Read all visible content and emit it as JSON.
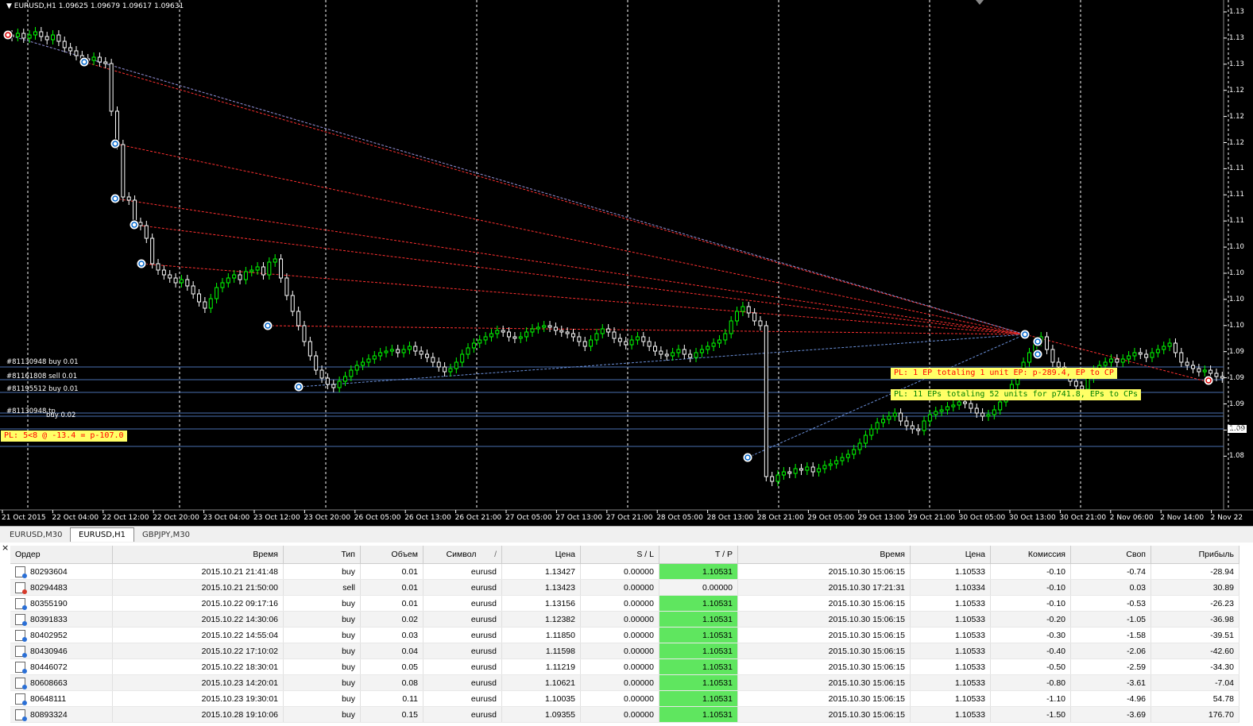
{
  "chart": {
    "title": "▼ EURUSD,H1  1.09625 1.09679 1.09617 1.09631",
    "price_axis": [
      "1.13",
      "1.13",
      "1.13",
      "1.12",
      "1.12",
      "1.12",
      "1.11",
      "1.11",
      "1.11",
      "1.10",
      "1.10",
      "1.10",
      "1.10",
      "1.09",
      "1.09",
      "1.09",
      "1.09",
      "1.08"
    ],
    "current_price": "1.09",
    "time_axis": [
      "21 Oct 2015",
      "22 Oct 04:00",
      "22 Oct 12:00",
      "22 Oct 20:00",
      "23 Oct 04:00",
      "23 Oct 12:00",
      "23 Oct 20:00",
      "26 Oct 05:00",
      "26 Oct 13:00",
      "26 Oct 21:00",
      "27 Oct 05:00",
      "27 Oct 13:00",
      "27 Oct 21:00",
      "28 Oct 05:00",
      "28 Oct 13:00",
      "28 Oct 21:00",
      "29 Oct 05:00",
      "29 Oct 13:00",
      "29 Oct 21:00",
      "30 Oct 05:00",
      "30 Oct 13:00",
      "30 Oct 21:00",
      "2 Nov 06:00",
      "2 Nov 14:00",
      "2 Nov 22"
    ],
    "order_labels": [
      "#81130948 buy 0.01",
      "#81161808 sell 0.01",
      "#81195512 buy 0.01",
      "#81130948 tp",
      "buy 0.02"
    ],
    "pl_labels": [
      "PL: 5<8 @ -13.4 = p-107.0",
      "PL: 1 EP totaling 1 unit EP: p-289.4, EP to CP",
      "PL: 11 EPs totaling 52 units for p741.8, EPs to CPs"
    ],
    "colors": {
      "bull": "#00ff00",
      "bear": "#ffffff",
      "grid": "#ffffff",
      "hline": "#4a6fb0",
      "red_line": "#ff3030",
      "blue_line": "#6a8fd8",
      "pl_bg": "#ffff66",
      "pl_red": "#ff0000",
      "pl_green": "#008000"
    }
  },
  "tabs": [
    {
      "label": "EURUSD,M30",
      "active": false
    },
    {
      "label": "EURUSD,H1",
      "active": true
    },
    {
      "label": "GBPJPY,M30",
      "active": false
    }
  ],
  "columns": [
    "Ордер",
    "Время",
    "Тип",
    "Объем",
    "Символ",
    "Цена",
    "S / L",
    "T / P",
    "Время",
    "Цена",
    "Комиссия",
    "Своп",
    "Прибыль"
  ],
  "sort_indicator": "/",
  "close_label": "×",
  "orders": [
    {
      "order": "80293604",
      "time": "2015.10.21 21:41:48",
      "type": "buy",
      "volume": "0.01",
      "symbol": "eurusd",
      "price": "1.13427",
      "sl": "0.00000",
      "tp": "1.10531",
      "close_time": "2015.10.30 15:06:15",
      "close_price": "1.10533",
      "commission": "-0.10",
      "swap": "-0.74",
      "profit": "-28.94"
    },
    {
      "order": "80294483",
      "time": "2015.10.21 21:50:00",
      "type": "sell",
      "volume": "0.01",
      "symbol": "eurusd",
      "price": "1.13423",
      "sl": "0.00000",
      "tp": "0.00000",
      "close_time": "2015.10.30 17:21:31",
      "close_price": "1.10334",
      "commission": "-0.10",
      "swap": "0.03",
      "profit": "30.89"
    },
    {
      "order": "80355190",
      "time": "2015.10.22 09:17:16",
      "type": "buy",
      "volume": "0.01",
      "symbol": "eurusd",
      "price": "1.13156",
      "sl": "0.00000",
      "tp": "1.10531",
      "close_time": "2015.10.30 15:06:15",
      "close_price": "1.10533",
      "commission": "-0.10",
      "swap": "-0.53",
      "profit": "-26.23"
    },
    {
      "order": "80391833",
      "time": "2015.10.22 14:30:06",
      "type": "buy",
      "volume": "0.02",
      "symbol": "eurusd",
      "price": "1.12382",
      "sl": "0.00000",
      "tp": "1.10531",
      "close_time": "2015.10.30 15:06:15",
      "close_price": "1.10533",
      "commission": "-0.20",
      "swap": "-1.05",
      "profit": "-36.98"
    },
    {
      "order": "80402952",
      "time": "2015.10.22 14:55:04",
      "type": "buy",
      "volume": "0.03",
      "symbol": "eurusd",
      "price": "1.11850",
      "sl": "0.00000",
      "tp": "1.10531",
      "close_time": "2015.10.30 15:06:15",
      "close_price": "1.10533",
      "commission": "-0.30",
      "swap": "-1.58",
      "profit": "-39.51"
    },
    {
      "order": "80430946",
      "time": "2015.10.22 17:10:02",
      "type": "buy",
      "volume": "0.04",
      "symbol": "eurusd",
      "price": "1.11598",
      "sl": "0.00000",
      "tp": "1.10531",
      "close_time": "2015.10.30 15:06:15",
      "close_price": "1.10533",
      "commission": "-0.40",
      "swap": "-2.06",
      "profit": "-42.60"
    },
    {
      "order": "80446072",
      "time": "2015.10.22 18:30:01",
      "type": "buy",
      "volume": "0.05",
      "symbol": "eurusd",
      "price": "1.11219",
      "sl": "0.00000",
      "tp": "1.10531",
      "close_time": "2015.10.30 15:06:15",
      "close_price": "1.10533",
      "commission": "-0.50",
      "swap": "-2.59",
      "profit": "-34.30"
    },
    {
      "order": "80608663",
      "time": "2015.10.23 14:20:01",
      "type": "buy",
      "volume": "0.08",
      "symbol": "eurusd",
      "price": "1.10621",
      "sl": "0.00000",
      "tp": "1.10531",
      "close_time": "2015.10.30 15:06:15",
      "close_price": "1.10533",
      "commission": "-0.80",
      "swap": "-3.61",
      "profit": "-7.04"
    },
    {
      "order": "80648111",
      "time": "2015.10.23 19:30:01",
      "type": "buy",
      "volume": "0.11",
      "symbol": "eurusd",
      "price": "1.10035",
      "sl": "0.00000",
      "tp": "1.10531",
      "close_time": "2015.10.30 15:06:15",
      "close_price": "1.10533",
      "commission": "-1.10",
      "swap": "-4.96",
      "profit": "54.78"
    },
    {
      "order": "80893324",
      "time": "2015.10.28 19:10:06",
      "type": "buy",
      "volume": "0.15",
      "symbol": "eurusd",
      "price": "1.09355",
      "sl": "0.00000",
      "tp": "1.10531",
      "close_time": "2015.10.30 15:06:15",
      "close_price": "1.10533",
      "commission": "-1.50",
      "swap": "-3.69",
      "profit": "176.70"
    }
  ]
}
